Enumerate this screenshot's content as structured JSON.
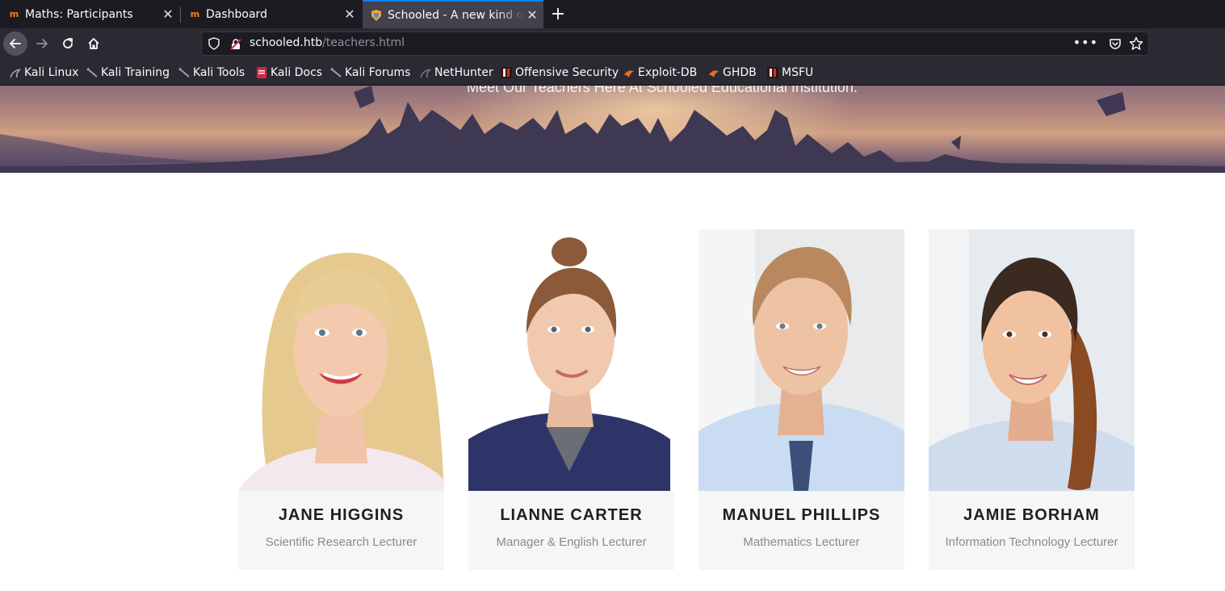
{
  "browser": {
    "tabs": [
      {
        "title": "Maths: Participants",
        "favicon": "moodle-icon",
        "active": false
      },
      {
        "title": "Dashboard",
        "favicon": "moodle-icon",
        "active": false
      },
      {
        "title": "Schooled - A new kind of",
        "favicon": "schooled-icon",
        "active": true
      }
    ],
    "new_tab_label": "+",
    "close_label": "✕",
    "url_host": "schooled.htb",
    "url_path": "/teachers.html",
    "more_label": "•••",
    "bookmarks": [
      {
        "label": "Kali Linux",
        "icon": "kali-dragon-icon"
      },
      {
        "label": "Kali Training",
        "icon": "kali-sword-icon"
      },
      {
        "label": "Kali Tools",
        "icon": "kali-sword-icon"
      },
      {
        "label": "Kali Docs",
        "icon": "kali-docs-icon"
      },
      {
        "label": "Kali Forums",
        "icon": "kali-sword-icon"
      },
      {
        "label": "NetHunter",
        "icon": "nethunter-icon"
      },
      {
        "label": "Offensive Security",
        "icon": "offsec-icon"
      },
      {
        "label": "Exploit-DB",
        "icon": "exploitdb-icon"
      },
      {
        "label": "GHDB",
        "icon": "exploitdb-icon"
      },
      {
        "label": "MSFU",
        "icon": "offsec-icon"
      }
    ]
  },
  "hero": {
    "subtitle": "Meet Our Teachers Here At Schooled Educational Institution."
  },
  "teachers": [
    {
      "name": "JANE HIGGINS",
      "role": "Scientific Research Lecturer"
    },
    {
      "name": "LIANNE CARTER",
      "role": "Manager & English Lecturer"
    },
    {
      "name": "MANUEL PHILLIPS",
      "role": "Mathematics Lecturer"
    },
    {
      "name": "JAMIE BORHAM",
      "role": "Information Technology Lecturer"
    }
  ],
  "colors": {
    "tab_accent": "#0a84ff",
    "chrome_dark": "#1c1b22",
    "chrome": "#2b2a33",
    "card_bg": "#f5f6f8",
    "name_text": "#1f1f1f",
    "role_text": "#8a8a8a"
  }
}
